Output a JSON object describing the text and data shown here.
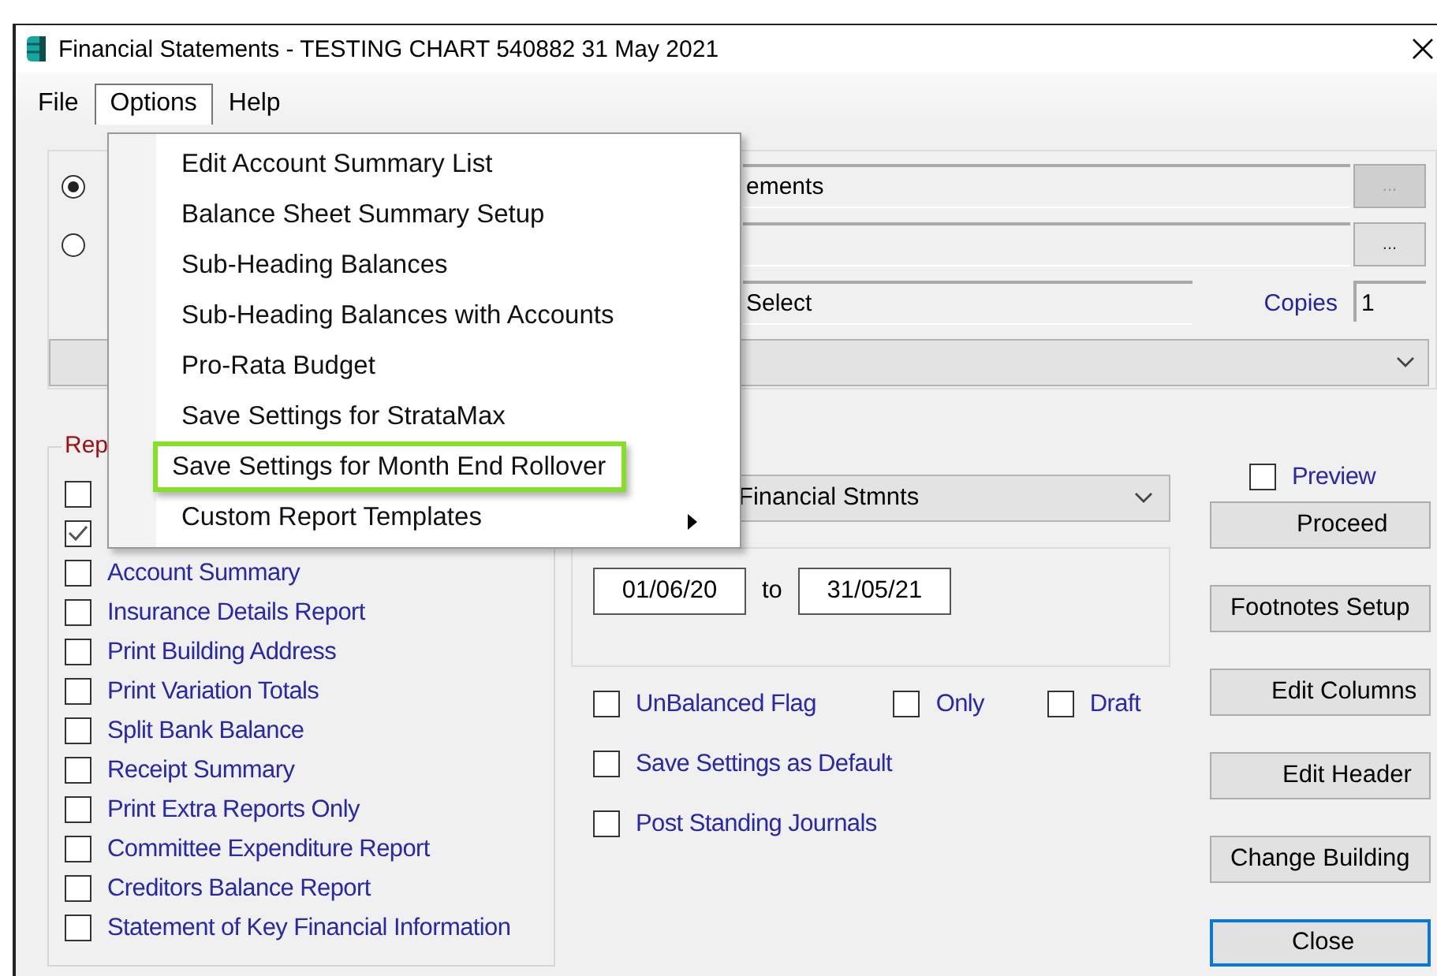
{
  "window": {
    "title": "Financial Statements - TESTING CHART 540882 31 May 2021"
  },
  "menu_bar": [
    {
      "label": "File",
      "selected": false
    },
    {
      "label": "Options",
      "selected": true
    },
    {
      "label": "Help",
      "selected": false
    }
  ],
  "options_menu": [
    {
      "label": "Edit Account Summary List",
      "selected": false,
      "submenu": false
    },
    {
      "label": "Balance Sheet Summary Setup",
      "selected": false,
      "submenu": false
    },
    {
      "label": "Sub-Heading Balances",
      "selected": false,
      "submenu": false
    },
    {
      "label": "Sub-Heading Balances with Accounts",
      "selected": false,
      "submenu": false
    },
    {
      "label": "Pro-Rata Budget",
      "selected": false,
      "submenu": false
    },
    {
      "label": "Save Settings for StrataMax",
      "selected": false,
      "submenu": false
    },
    {
      "label": "Save Settings for Month End Rollover",
      "selected": true,
      "submenu": false
    },
    {
      "label": "Custom Report Templates",
      "selected": false,
      "submenu": true
    }
  ],
  "source": {
    "radios": [
      {
        "selected": true
      },
      {
        "selected": false
      }
    ],
    "field_1": {
      "value": "ements",
      "browse": "...",
      "browse_disabled": true
    },
    "field_2": {
      "browse": "...",
      "browse_disabled": false
    },
    "field_3": {
      "value": "Select"
    },
    "copies": {
      "label": "Copies",
      "value": "1"
    }
  },
  "report_group": {
    "label": "Rep",
    "options": [
      {
        "checked": false
      },
      {
        "checked": true
      },
      {
        "label": "Account Summary",
        "checked": false
      },
      {
        "label": "Insurance Details Report",
        "checked": false
      },
      {
        "label": "Print Building Address",
        "checked": false
      },
      {
        "label": "Print Variation Totals",
        "checked": false
      },
      {
        "label": "Split Bank Balance",
        "checked": false
      },
      {
        "label": "Receipt Summary",
        "checked": false
      },
      {
        "label": "Print Extra Reports Only",
        "checked": false
      },
      {
        "label": "Committee Expenditure Report",
        "checked": false
      },
      {
        "label": "Creditors Balance Report",
        "checked": false
      },
      {
        "label": "Statement of Key Financial Information",
        "checked": false
      }
    ]
  },
  "report_type": {
    "value": "Financial Stmnts"
  },
  "period": {
    "from": "01/06/20",
    "to_label": "to",
    "to": "31/05/21"
  },
  "flags": [
    [
      {
        "label": "UnBalanced Flag",
        "checked": false
      },
      {
        "label": "Only",
        "checked": false
      },
      {
        "label": "Draft",
        "checked": false
      }
    ],
    [
      {
        "label": "Save Settings as Default",
        "checked": false
      }
    ],
    [
      {
        "label": "Post Standing Journals",
        "checked": false
      }
    ]
  ],
  "preview": {
    "label": "Preview",
    "checked": false
  },
  "buttons": [
    {
      "label": "Proceed",
      "focused": false
    },
    {
      "label": "Footnotes Setup",
      "focused": false
    },
    {
      "label": "Edit Columns",
      "focused": false
    },
    {
      "label": "Edit Header",
      "focused": false
    },
    {
      "label": "Change Building",
      "focused": false
    },
    {
      "label": "Close",
      "focused": true
    }
  ]
}
